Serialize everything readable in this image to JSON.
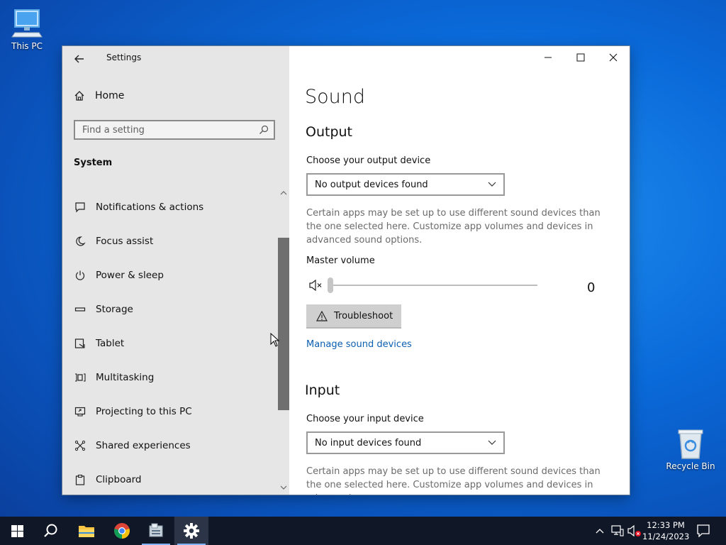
{
  "desktop": {
    "icons": [
      {
        "label": "This PC"
      },
      {
        "label": "Recycle Bin"
      }
    ]
  },
  "window": {
    "app_title": "Settings",
    "controls": {
      "minimize": "minimize-icon",
      "maximize": "maximize-icon",
      "close": "close-icon"
    }
  },
  "sidebar": {
    "home_label": "Home",
    "search_placeholder": "Find a setting",
    "section": "System",
    "items": [
      {
        "label": "Notifications & actions",
        "icon": "notifications-icon"
      },
      {
        "label": "Focus assist",
        "icon": "moon-icon"
      },
      {
        "label": "Power & sleep",
        "icon": "power-icon"
      },
      {
        "label": "Storage",
        "icon": "storage-icon"
      },
      {
        "label": "Tablet",
        "icon": "tablet-icon"
      },
      {
        "label": "Multitasking",
        "icon": "multitasking-icon"
      },
      {
        "label": "Projecting to this PC",
        "icon": "projecting-icon"
      },
      {
        "label": "Shared experiences",
        "icon": "shared-experiences-icon"
      },
      {
        "label": "Clipboard",
        "icon": "clipboard-icon"
      }
    ]
  },
  "content": {
    "page_title": "Sound",
    "output": {
      "heading": "Output",
      "device_label": "Choose your output device",
      "device_value": "No output devices found",
      "description": "Certain apps may be set up to use different sound devices than the one selected here. Customize app volumes and devices in advanced sound options.",
      "master_volume_label": "Master volume",
      "master_volume_value": "0",
      "troubleshoot_label": "Troubleshoot",
      "manage_link": "Manage sound devices"
    },
    "input": {
      "heading": "Input",
      "device_label": "Choose your input device",
      "device_value": "No input devices found",
      "description": "Certain apps may be set up to use different sound devices than the one selected here. Customize app volumes and devices in advanced"
    }
  },
  "taskbar": {
    "time": "12:33 PM",
    "date": "11/24/2023",
    "colors": {
      "background": "#101727",
      "accent": "#7fb3f5"
    }
  }
}
